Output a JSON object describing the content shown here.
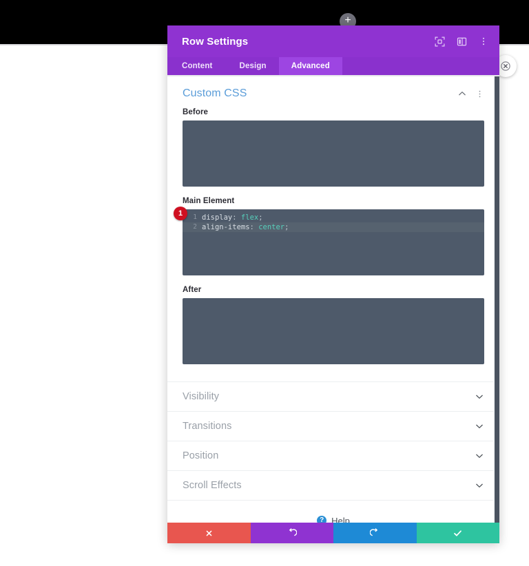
{
  "page": {
    "add_button_icon": "plus-icon",
    "close_button_icon": "close-circle-icon"
  },
  "modal": {
    "title": "Row Settings",
    "header_icons": [
      {
        "name": "fullscreen-icon",
        "label": "Fullscreen"
      },
      {
        "name": "layout-panel-icon",
        "label": "Change Layout"
      },
      {
        "name": "more-vertical-icon",
        "label": "More Options"
      }
    ],
    "tabs": [
      {
        "label": "Content",
        "active": false
      },
      {
        "label": "Design",
        "active": false
      },
      {
        "label": "Advanced",
        "active": true
      }
    ],
    "open_section": {
      "title": "Custom CSS",
      "collapse_icon": "chevron-up-icon",
      "options_icon": "more-vertical-icon",
      "fields": [
        {
          "label": "Before",
          "value": "",
          "lines": []
        },
        {
          "label": "Main Element",
          "lines": [
            {
              "number": "1",
              "property": "display",
              "value": "flex",
              "highlighted": false
            },
            {
              "number": "2",
              "property": "align-items",
              "value": "center",
              "highlighted": true
            }
          ]
        },
        {
          "label": "After",
          "value": "",
          "lines": []
        }
      ]
    },
    "collapsed_sections": [
      {
        "label": "Visibility",
        "icon": "chevron-down-icon"
      },
      {
        "label": "Transitions",
        "icon": "chevron-down-icon"
      },
      {
        "label": "Position",
        "icon": "chevron-down-icon"
      },
      {
        "label": "Scroll Effects",
        "icon": "chevron-down-icon"
      }
    ],
    "help": {
      "label": "Help",
      "badge": "?"
    },
    "footer_buttons": [
      {
        "name": "cancel-button",
        "icon": "x-icon",
        "color": "#e8564f"
      },
      {
        "name": "undo-button",
        "icon": "undo-icon",
        "color": "#8f33d1"
      },
      {
        "name": "redo-button",
        "icon": "redo-icon",
        "color": "#1e8ad6"
      },
      {
        "name": "save-button",
        "icon": "check-icon",
        "color": "#2ec4a0"
      }
    ]
  },
  "annotations": [
    {
      "label": "1",
      "color": "#cf1021"
    }
  ],
  "colors": {
    "header_purple": "#8f33d1",
    "tab_active": "#9d45e2",
    "section_title_blue": "#5b9dd9",
    "code_bg": "#4e5a6a",
    "code_value": "#56cfbb",
    "marker_red": "#cf1021"
  }
}
